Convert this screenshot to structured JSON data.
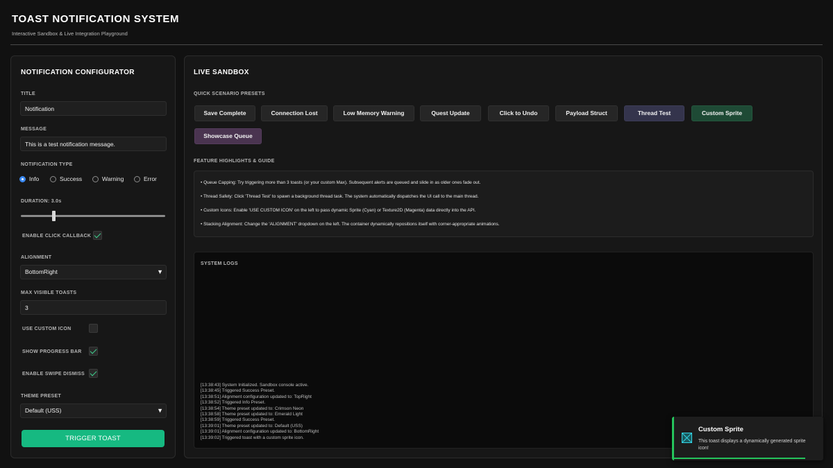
{
  "header": {
    "title": "TOAST NOTIFICATION SYSTEM",
    "subtitle": "Interactive Sandbox & Live Integration Playground"
  },
  "configurator": {
    "title": "NOTIFICATION CONFIGURATOR",
    "title_label": "TITLE",
    "title_value": "Notification",
    "message_label": "MESSAGE",
    "message_value": "This is a test notification message.",
    "type_label": "NOTIFICATION TYPE",
    "types": [
      {
        "label": "Info",
        "checked": true
      },
      {
        "label": "Success",
        "checked": false
      },
      {
        "label": "Warning",
        "checked": false
      },
      {
        "label": "Error",
        "checked": false
      }
    ],
    "duration_label": "DURATION: 3.0s",
    "duration_fraction": 0.22,
    "click_callback_label": "ENABLE CLICK CALLBACK",
    "click_callback_checked": true,
    "alignment_label": "ALIGNMENT",
    "alignment_value": "BottomRight",
    "max_visible_label": "MAX VISIBLE TOASTS",
    "max_visible_value": "3",
    "custom_icon_label": "USE CUSTOM ICON",
    "custom_icon_checked": false,
    "progress_bar_label": "SHOW PROGRESS BAR",
    "progress_bar_checked": true,
    "swipe_dismiss_label": "ENABLE SWIPE DISMISS",
    "swipe_dismiss_checked": true,
    "theme_label": "THEME PRESET",
    "theme_value": "Default (USS)",
    "trigger_label": "TRIGGER TOAST"
  },
  "sandbox": {
    "title": "LIVE SANDBOX",
    "presets_label": "QUICK SCENARIO PRESETS",
    "presets": [
      {
        "label": "Save Complete"
      },
      {
        "label": "Connection Lost"
      },
      {
        "label": "Low Memory Warning"
      },
      {
        "label": "Quest Update"
      },
      {
        "label": "Click to Undo"
      },
      {
        "label": "Payload Struct"
      },
      {
        "label": "Thread Test",
        "color": "#34344c"
      },
      {
        "label": "Custom Sprite",
        "color": "#1e4a35"
      },
      {
        "label": "Showcase Queue",
        "color": "#4a3450"
      }
    ],
    "features_label": "FEATURE HIGHLIGHTS & GUIDE",
    "features": [
      "• Queue Capping: Try triggering more than 3 toasts (or your custom Max). Subsequent alerts are queued and slide in as older ones fade out.",
      "• Thread Safety: Click 'Thread Test' to spawn a background thread task. The system automatically dispatches the UI call to the main thread.",
      "• Custom Icons: Enable 'USE CUSTOM ICON' on the left to pass dynamic Sprite (Cyan) or Texture2D (Magenta) data directly into the API.",
      "• Stacking Alignment: Change the 'ALIGNMENT' dropdown on the left. The container dynamically repositions itself with corner-appropriate animations."
    ],
    "logs_label": "SYSTEM LOGS",
    "logs": [
      "[13:38:43] System Initialized. Sandbox console active.",
      "[13:38:45] Triggered Success Preset.",
      "[13:38:51] Alignment configuration updated to: TopRight",
      "[13:38:52] Triggered Info Preset.",
      "[13:38:54] Theme preset updated to: Crimson Neon",
      "[13:38:58] Theme preset updated to: Emerald Light",
      "[13:38:59] Triggered Success Preset.",
      "[13:39:01] Theme preset updated to: Default (USS)",
      "[13:39:01] Alignment configuration updated to: BottomRight",
      "[13:39:02] Triggered toast with a custom sprite icon."
    ]
  },
  "toast": {
    "title": "Custom Sprite",
    "message": "This toast displays a dynamically generated sprite icon!",
    "accent": "#25c45c",
    "icon": "custom-sprite-icon"
  },
  "colors": {
    "background": "#111111",
    "panel": "#171717",
    "accent_green": "#16b981",
    "radio_blue": "#3a88f0",
    "check_green": "#3fd28f"
  }
}
